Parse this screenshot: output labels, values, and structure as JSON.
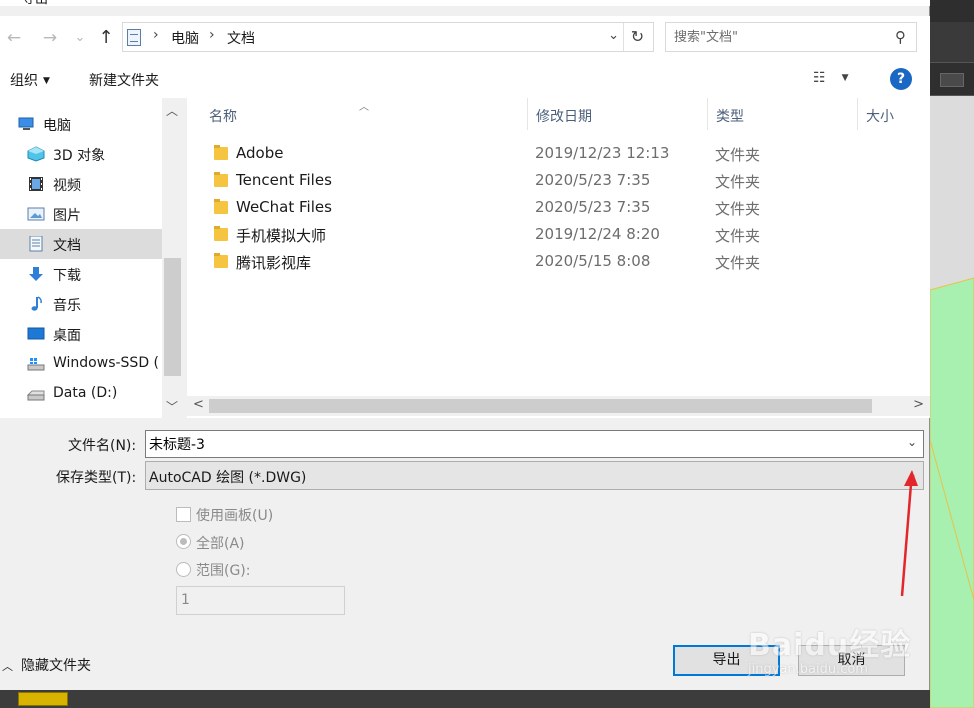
{
  "dialog": {
    "title": "导出",
    "close_glyph": "✕"
  },
  "nav": {
    "back_glyph": "←",
    "forward_glyph": "→",
    "history_glyph": "⌄",
    "up_glyph": "↑"
  },
  "address": {
    "crumbs": [
      "电脑",
      "文档"
    ],
    "separator": "›",
    "dropdown_glyph": "⌄",
    "refresh_glyph": "↻"
  },
  "search": {
    "placeholder": "搜索\"文档\"",
    "icon": "search-icon"
  },
  "toolbar": {
    "organize_label": "组织",
    "new_folder_label": "新建文件夹",
    "view_glyph": "☷",
    "help_glyph": "?"
  },
  "sidebar": {
    "items": [
      {
        "label": "电脑",
        "icon": "computer-icon"
      },
      {
        "label": "3D 对象",
        "icon": "3d-objects-icon"
      },
      {
        "label": "视频",
        "icon": "video-icon"
      },
      {
        "label": "图片",
        "icon": "pictures-icon"
      },
      {
        "label": "文档",
        "icon": "documents-icon",
        "selected": true
      },
      {
        "label": "下载",
        "icon": "download-icon"
      },
      {
        "label": "音乐",
        "icon": "music-icon"
      },
      {
        "label": "桌面",
        "icon": "desktop-icon"
      },
      {
        "label": "Windows-SSD (",
        "icon": "drive-windows-icon"
      },
      {
        "label": "Data (D:)",
        "icon": "drive-icon"
      }
    ]
  },
  "filelist": {
    "columns": [
      "名称",
      "修改日期",
      "类型",
      "大小"
    ],
    "rows": [
      {
        "name": "Adobe",
        "date": "2019/12/23 12:13",
        "type": "文件夹"
      },
      {
        "name": "Tencent Files",
        "date": "2020/5/23 7:35",
        "type": "文件夹"
      },
      {
        "name": "WeChat Files",
        "date": "2020/5/23 7:35",
        "type": "文件夹"
      },
      {
        "name": "手机模拟大师",
        "date": "2019/12/24 8:20",
        "type": "文件夹"
      },
      {
        "name": "腾讯影视库",
        "date": "2020/5/15 8:08",
        "type": "文件夹"
      }
    ]
  },
  "form": {
    "filename_label": "文件名(N):",
    "filename_value": "未标题-3",
    "filetype_label": "保存类型(T):",
    "filetype_value": "AutoCAD 绘图 (*.DWG)",
    "use_artboard_label": "使用画板(U)",
    "all_label": "全部(A)",
    "range_label": "范围(G):",
    "range_value": "1"
  },
  "footer": {
    "hide_folders_label": "隐藏文件夹",
    "export_label": "导出",
    "cancel_label": "取消"
  },
  "watermark": {
    "brand": "Baidu经验",
    "url": "jingyan.baidu.com"
  },
  "colors": {
    "accent": "#0078d7",
    "annotation_arrow": "#e3262b",
    "background_shape": "#a8f0b0"
  }
}
